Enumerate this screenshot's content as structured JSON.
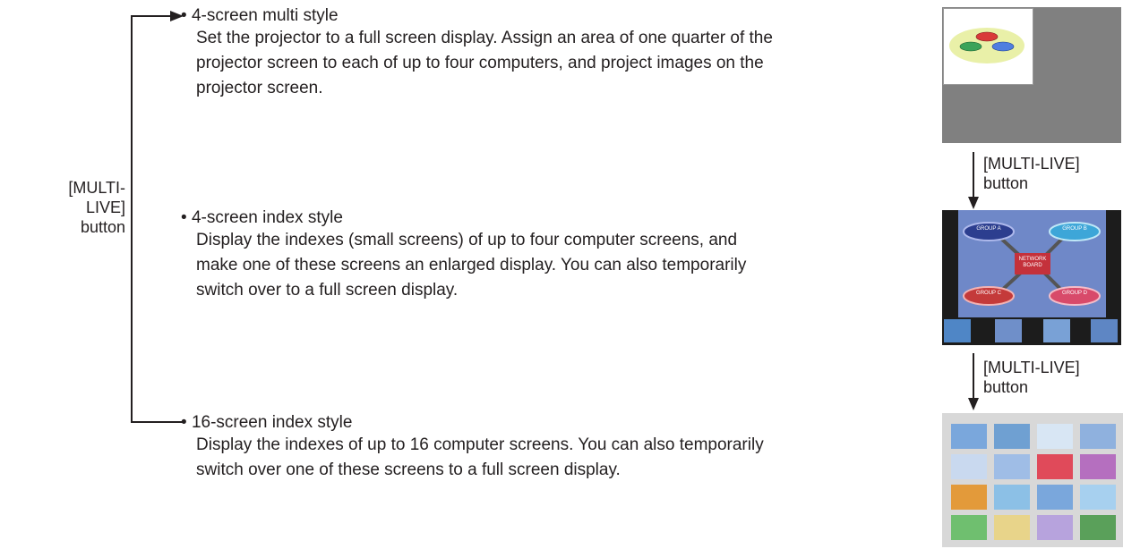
{
  "side_label": {
    "line1": "[MULTI-LIVE]",
    "line2": "button"
  },
  "items": [
    {
      "title": "4-screen multi style",
      "desc": [
        "Set the projector to a full screen display. Assign an area of one quarter of the",
        "projector screen to each of up to four computers, and project images on the",
        "projector screen."
      ]
    },
    {
      "title": "4-screen index style",
      "desc": [
        "Display the indexes (small screens) of up to four computer screens, and",
        "make one of these screens an enlarged display. You can also temporarily",
        "switch over to a full screen display."
      ]
    },
    {
      "title": "16-screen index style",
      "desc": [
        "Display the indexes of up to 16 computer screens. You can also temporarily",
        "switch over one of these screens to a full screen display."
      ]
    }
  ],
  "arrow_labels": [
    {
      "line1": "[MULTI-LIVE]",
      "line2": "button"
    },
    {
      "line1": "[MULTI-LIVE]",
      "line2": "button"
    }
  ],
  "diagram": {
    "groups": [
      "GROUP A",
      "GROUP B",
      "GROUP C",
      "GROUP D"
    ],
    "center": [
      "NETWORK",
      "BOARD"
    ]
  },
  "colors": {
    "text": "#231f20",
    "screen_gray": "#808080",
    "board_blue": "#6f88c8",
    "center_red": "#c4313b"
  }
}
